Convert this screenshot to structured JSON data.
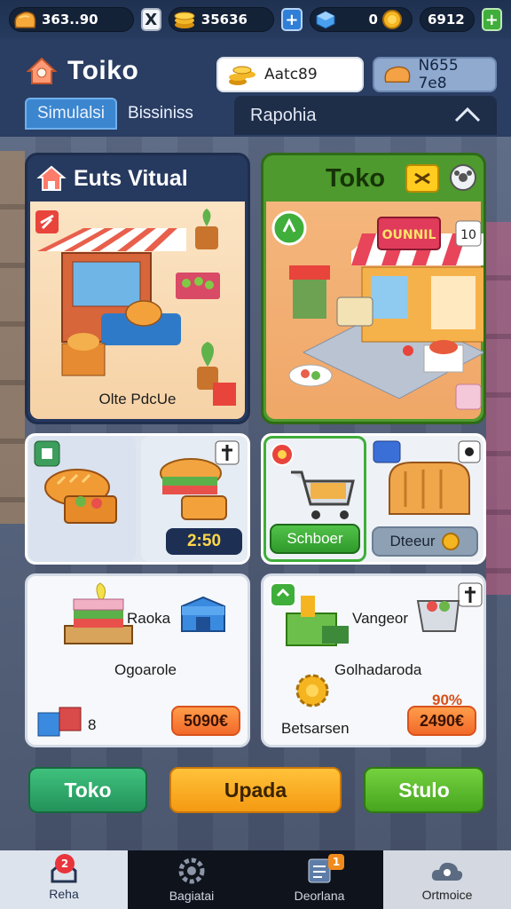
{
  "topbar": {
    "bread": "363..90",
    "coins": "35636",
    "blue_count": "0",
    "gold_count": "6912",
    "x_label": "X",
    "plus_label": "+"
  },
  "header": {
    "title": "Toiko",
    "pill_a": "Aatc89",
    "pill_b": "N655 7e8",
    "tabs": [
      "Simulalsi",
      "Bissiniss"
    ],
    "right_tab": "Rapohia"
  },
  "cards": {
    "left_title": "Euts Vitual",
    "left_caption": "Olte PdcUe",
    "right_title": "Toko",
    "right_sign": "OUNNIL",
    "right_badge": "10",
    "time_value": "2:50",
    "btn_green": "Schboer",
    "btn_gray": "Dteeur",
    "low_left_a": "Raoka",
    "low_left_b": "Ogoarole",
    "low_left_count": "8",
    "low_left_price": "5090€",
    "low_right_a": "Vangeor",
    "low_right_b": "Golhadaroda",
    "low_right_c": "Betsarsen",
    "low_right_small": "90%",
    "low_right_price": "2490€"
  },
  "actions": {
    "toko": "Toko",
    "upada": "Upada",
    "stulo": "Stulo"
  },
  "nav": [
    {
      "label": "Reha",
      "badge": "2"
    },
    {
      "label": "Bagiatai"
    },
    {
      "label": "Deorlana",
      "badge": "1"
    },
    {
      "label": "Ortmoice"
    }
  ],
  "colors": {
    "accent_blue": "#3b86cf",
    "green": "#4e9a2e",
    "orange": "#f49a12"
  }
}
